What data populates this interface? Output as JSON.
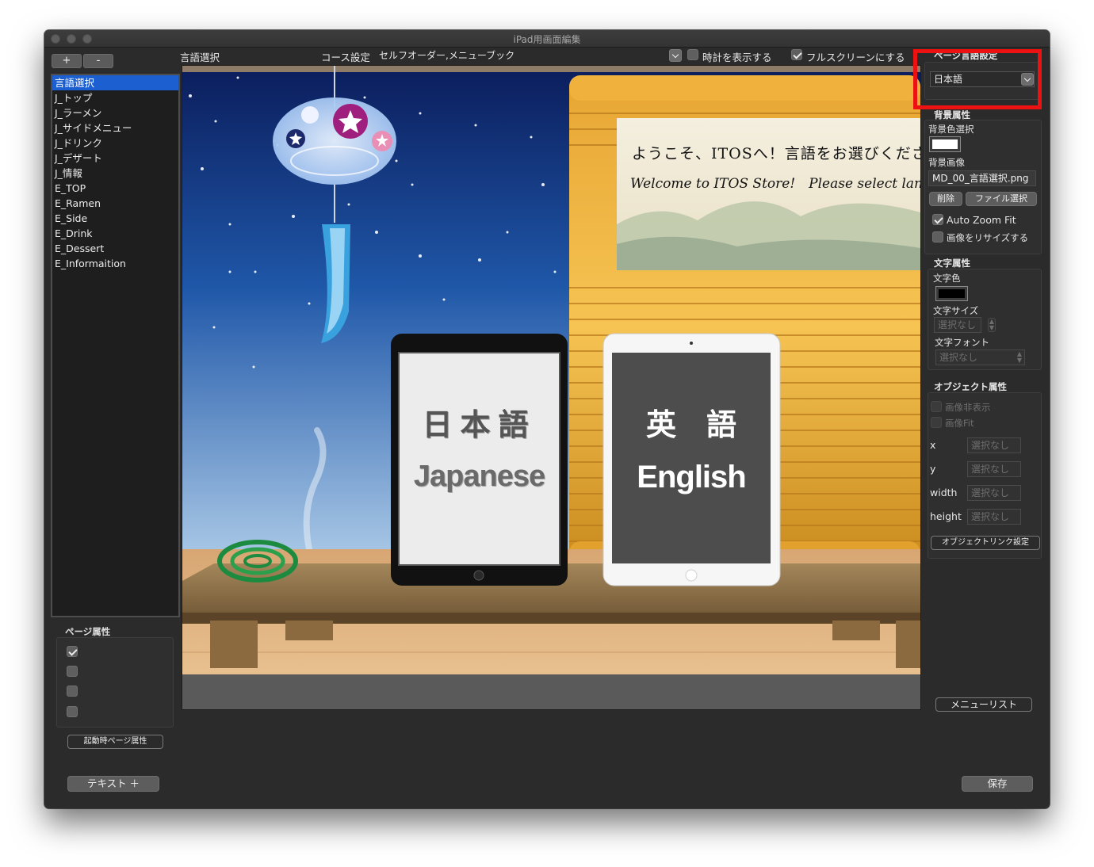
{
  "window": {
    "title": "iPad用画面編集"
  },
  "page_list": {
    "add_label": "+",
    "remove_label": "-",
    "items": [
      "言語選択",
      "J_トップ",
      "J_ラーメン",
      "J_サイドメニュー",
      "J_ドリンク",
      "J_デザート",
      "J_情報",
      "E_TOP",
      "E_Ramen",
      "E_Side",
      "E_Drink",
      "E_Dessert",
      "E_Informaition"
    ],
    "selected_index": 0
  },
  "page_props": {
    "title": "ページ属性",
    "checkboxes": [
      true,
      false,
      false,
      false
    ],
    "startup_button": "起動時ページ属性"
  },
  "bottom": {
    "text_add_button": "テキスト ＋",
    "save_button": "保存"
  },
  "topbar": {
    "current_page": "言語選択",
    "course_label": "コース設定",
    "course_value": "セルフオーダー,メニューブック",
    "show_clock_label": "時計を表示する",
    "show_clock_checked": false,
    "fullscreen_label": "フルスクリーンにする",
    "fullscreen_checked": true
  },
  "canvas": {
    "sign_line1": "ようこそ、ITOSへ！言語をお選びください",
    "sign_line2": "Welcome to ITOS Store!　Please select language.",
    "japanese_button": {
      "kanji": "日本語",
      "english": "Japanese"
    },
    "english_button": {
      "kanji": "英　語",
      "english": "English"
    }
  },
  "right_panel": {
    "page_language": {
      "title": "ページ言語設定",
      "value": "日本語"
    },
    "background": {
      "title": "背景属性",
      "color_label": "背景色選択",
      "color": "#ffffff",
      "image_label": "背景画像",
      "image_value": "MD_00_言語選択.png",
      "delete_button": "削除",
      "file_button": "ファイル選択",
      "auto_zoom_label": "Auto Zoom Fit",
      "auto_zoom_checked": true,
      "resize_label": "画像をリサイズする",
      "resize_checked": false
    },
    "text": {
      "title": "文字属性",
      "color_label": "文字色",
      "color": "#000000",
      "size_label": "文字サイズ",
      "size_value": "選択なし",
      "font_label": "文字フォント",
      "font_value": "選択なし"
    },
    "object": {
      "title": "オブジェクト属性",
      "hide_label": "画像非表示",
      "fit_label": "画像Fit",
      "x_label": "x",
      "x_value": "選択なし",
      "y_label": "y",
      "y_value": "選択なし",
      "width_label": "width",
      "width_value": "選択なし",
      "height_label": "height",
      "height_value": "選択なし",
      "link_button": "オブジェクトリンク設定"
    },
    "menu_list_button": "メニューリスト"
  },
  "colors": {
    "selection": "#1b5fd1",
    "highlight_box": "#ec1212",
    "window_bg": "#2b2b2b"
  }
}
